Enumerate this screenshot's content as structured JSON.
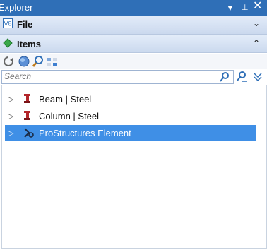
{
  "titlebar": {
    "title": "Explorer",
    "dropdown_icon": "chevron-down",
    "pin_icon": "pin",
    "close_icon": "close"
  },
  "sections": {
    "file": {
      "label": "File",
      "icon": "v8-file-icon",
      "toggle": "chevron-down"
    },
    "items": {
      "label": "Items",
      "icon": "green-diamond-icon",
      "toggle": "chevron-up"
    }
  },
  "toolbar": {
    "buttons": [
      "refresh",
      "globe",
      "zoom",
      "grid-view"
    ]
  },
  "search": {
    "placeholder": "Search",
    "value": ""
  },
  "tree": {
    "rows": [
      {
        "label": "Beam | Steel",
        "icon": "steel-beam-icon",
        "selected": false
      },
      {
        "label": "Column | Steel",
        "icon": "steel-column-icon",
        "selected": false
      },
      {
        "label": "ProStructures Element",
        "icon": "prostructures-icon",
        "selected": true
      }
    ]
  },
  "colors": {
    "titlebar": "#2f6fb7",
    "selected_row": "#3f8fe6"
  }
}
